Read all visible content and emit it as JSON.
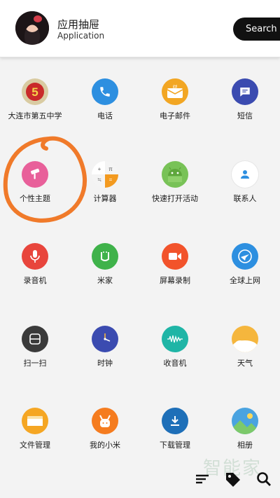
{
  "header": {
    "title": "应用抽屉",
    "subtitle": "Application",
    "search_label": "Search"
  },
  "apps": [
    {
      "label": "大连市第五中学",
      "icon": "school-logo-icon",
      "color": "#e6d9b8"
    },
    {
      "label": "电话",
      "icon": "phone-icon",
      "color": "#2d8fe0"
    },
    {
      "label": "电子邮件",
      "icon": "mail-icon",
      "color": "#f2a623"
    },
    {
      "label": "短信",
      "icon": "message-icon",
      "color": "#3b4bb0"
    },
    {
      "label": "个性主题",
      "icon": "theme-brush-icon",
      "color": "#e8609a"
    },
    {
      "label": "计算器",
      "icon": "calculator-icon",
      "color": "#f1f1f1"
    },
    {
      "label": "快速打开活动",
      "icon": "android-icon",
      "color": "#78c257"
    },
    {
      "label": "联系人",
      "icon": "contact-icon",
      "color": "#ffffff"
    },
    {
      "label": "录音机",
      "icon": "microphone-icon",
      "color": "#e8453c"
    },
    {
      "label": "米家",
      "icon": "mijia-icon",
      "color": "#3fb24a"
    },
    {
      "label": "屏幕录制",
      "icon": "video-record-icon",
      "color": "#f2532b"
    },
    {
      "label": "全球上网",
      "icon": "globe-plane-icon",
      "color": "#2d8fe0"
    },
    {
      "label": "扫一扫",
      "icon": "scan-icon",
      "color": "#3a3a3a"
    },
    {
      "label": "时钟",
      "icon": "clock-icon",
      "color": "#3b4bb0"
    },
    {
      "label": "收音机",
      "icon": "radio-icon",
      "color": "#1fb5a6"
    },
    {
      "label": "天气",
      "icon": "weather-icon",
      "color": "#f5b63d"
    },
    {
      "label": "文件管理",
      "icon": "folder-icon",
      "color": "#f5a623"
    },
    {
      "label": "我的小米",
      "icon": "mi-bunny-icon",
      "color": "#f57c1f"
    },
    {
      "label": "下载管理",
      "icon": "download-icon",
      "color": "#1e6fb8"
    },
    {
      "label": "相册",
      "icon": "gallery-icon",
      "color": "#4aa3e0"
    }
  ],
  "bottom_bar": {
    "sort_icon": "sort-icon",
    "tag_icon": "tag-icon",
    "search_icon": "search-icon"
  },
  "watermark": "智能家",
  "annotation_color": "#f07a2a"
}
